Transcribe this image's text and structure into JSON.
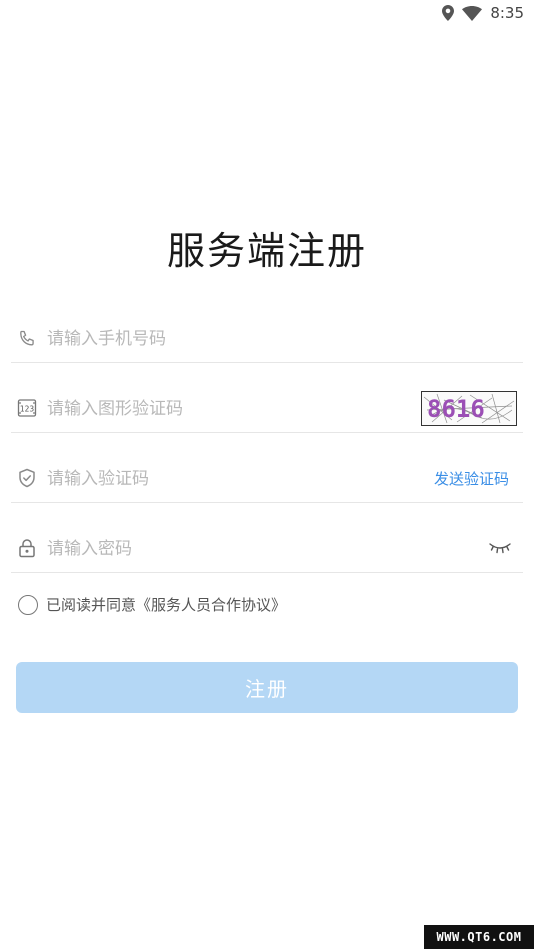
{
  "status_bar": {
    "time": "8:35",
    "icons": [
      "location-icon",
      "wifi-icon"
    ]
  },
  "title": "服务端注册",
  "form": {
    "phone": {
      "placeholder": "请输入手机号码",
      "icon": "phone-icon"
    },
    "captcha": {
      "placeholder": "请输入图形验证码",
      "icon": "number-123-icon",
      "captcha_text": "8616"
    },
    "sms": {
      "placeholder": "请输入验证码",
      "icon": "shield-check-icon",
      "send_label": "发送验证码"
    },
    "password": {
      "placeholder": "请输入密码",
      "icon": "lock-icon",
      "toggle_icon": "eye-closed-icon"
    }
  },
  "agreement": {
    "text": "已阅读并同意《服务人员合作协议》",
    "checked": false
  },
  "submit": {
    "label": "注册",
    "color": "#b4d7f5"
  },
  "accent_color": "#3a8ee6",
  "watermark": "WWW.QT6.COM"
}
